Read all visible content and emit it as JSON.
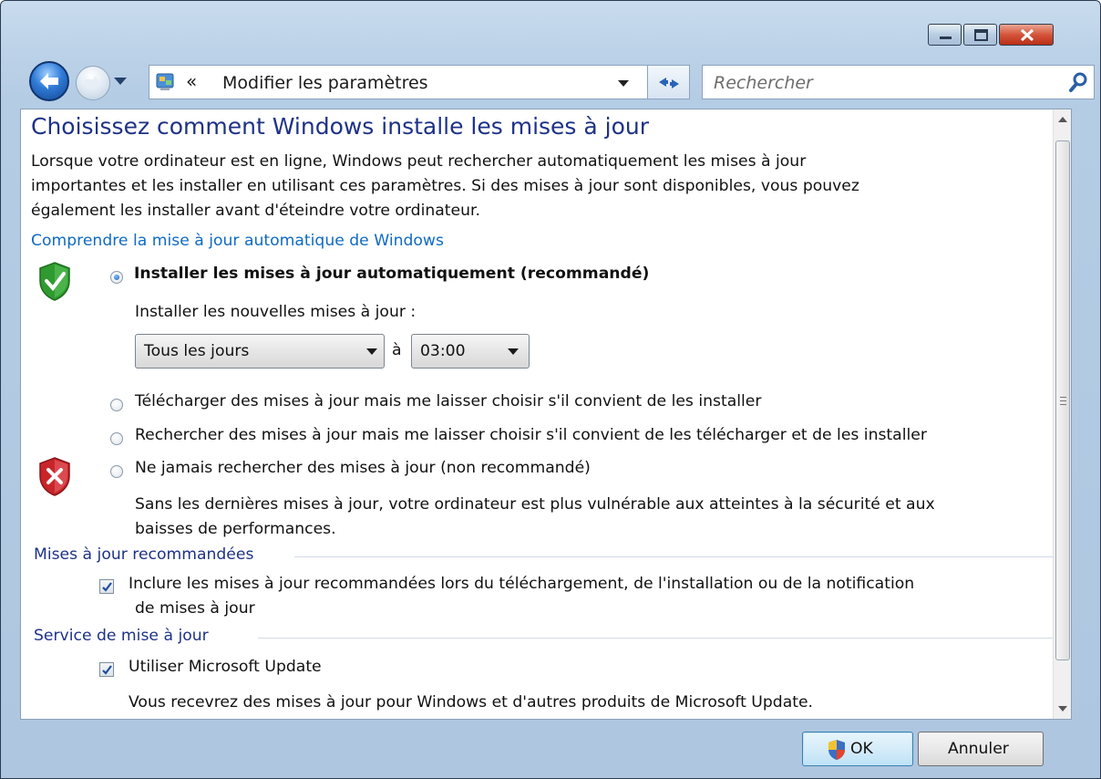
{
  "nav": {
    "address_path": "Modifier les paramètres",
    "search_placeholder": "Rechercher"
  },
  "content": {
    "heading": "Choisissez comment Windows installe les mises à jour",
    "intro_lines": [
      "Lorsque votre ordinateur est en ligne, Windows peut rechercher automatiquement les mises à jour",
      "importantes et les installer en utilisant ces paramètres. Si des mises à jour sont disponibles, vous pouvez",
      "également les installer avant d'éteindre votre ordinateur."
    ],
    "help_link": "Comprendre la mise à jour automatique de Windows",
    "options": [
      {
        "label": "Installer les mises à jour automatiquement (recommandé)",
        "selected": true
      },
      {
        "label": "Télécharger des mises à jour mais me laisser choisir s'il convient de les installer",
        "selected": false
      },
      {
        "label": "Rechercher des mises à jour mais me laisser choisir s'il convient de les télécharger et de les installer",
        "selected": false
      },
      {
        "label": "Ne jamais rechercher des mises à jour (non recommandé)",
        "selected": false
      }
    ],
    "schedule_label": "Installer les nouvelles mises à jour :",
    "day_value": "Tous les jours",
    "at_label": "à",
    "time_value": "03:00",
    "warning_lines": [
      "Sans les dernières mises à jour, votre ordinateur est plus vulnérable aux atteintes à la sécurité et aux",
      "baisses de performances."
    ],
    "recommended_section": "Mises à jour recommandées",
    "recommended_check_lines": [
      "Inclure les mises à jour recommandées lors du téléchargement, de l'installation ou de la notification",
      "de mises à jour"
    ],
    "recommended_checked": true,
    "service_section": "Service de mise à jour",
    "service_check": "Utiliser Microsoft Update",
    "service_checked": true,
    "service_note": "Vous recevrez des mises à jour pour Windows et d'autres produits de Microsoft Update."
  },
  "buttons": {
    "ok": "OK",
    "cancel": "Annuler"
  },
  "colors": {
    "heading": "#1e3287",
    "link": "#0f6ac4",
    "shield_ok": "#2f9a2f",
    "shield_error": "#c8252a"
  }
}
